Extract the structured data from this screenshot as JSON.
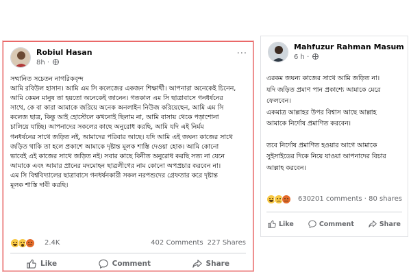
{
  "post1": {
    "author": "Robiul Hasan",
    "time": "8h",
    "more": "···",
    "lines": [
      "সম্মানিত সচেতন নাগরিকবৃন্দ",
      "আমি রবিউল হাসান। আমি এম সি কলেজের একজন শিক্ষার্থী। আপনারা অনেকেই চিনেন,",
      "আমি কেমন মানুষ তা হয়তো অনেকেই জানেন। গতকাল এম সি ছাত্রাবাসে গনধর্ষনের",
      "সাথে, কে বা কারা আমাকে জরিয়ে অনেক অনলাইন নিউজ করিয়েছেন, আমি এম সি",
      "কলেজ ছাত্র, কিন্তু আই হোস্টেলে কখনোই ছিলাম না, আমি বাসায় থেকে পড়াশোনা",
      "চালিয়ে যাচ্ছি। আপনাদের সকলের কাছে অনুরোধ করছি, আমি যদি এই নির্মম",
      "গনধর্ষনের সাথে জড়িত নই, আমাদের পরিবার আছে। যদি আমি এই জঘন্য কাজের সাথে",
      "জড়িত থাকি তা হলে প্রকাশে আমাকে দৃষ্টান্ত মূলক শাস্তি দেওয়া হোক। আমি কোনো",
      "ভাবেই এই কাজের সাথে জড়িত নই। সবার কাছে বিনীত অনুরোধ করছি সত্য না যেনে",
      "আমাকে এবং আমার প্রানের মদমোহন ছাত্রলীগের নাম কোনো অপপ্রচার করবেন না।",
      "এম সি বিশ্ববিদ্যালের ছাত্রাবাসে গনধর্ষনকারী সকল নরপশুদের গ্রেফতার করে দৃষ্টান্ত",
      "মূলক শাস্তি দাবী করছি।"
    ],
    "reactions_count": "2.4K",
    "comments": "402 Comments",
    "shares": "227 Shares",
    "like": "Like",
    "comment": "Comment",
    "share": "Share"
  },
  "post2": {
    "author": "Mahfuzur Rahman Masum",
    "time": "6 h",
    "more": "···",
    "lines": [
      "এরকম জঘন্য কাজের সাথে আমি জড়িত না।",
      "যদি জড়িত প্রমাণ পান প্রকাশ্যে আমাকে মেরে",
      "ফেলবেন।",
      "একমাত্র আল্লাহর উপর বিশ্বাস আছে আল্লাহ",
      "আমাকে নির্দোষ প্রমাণিত করবেন।"
    ],
    "lines_b": [
      "তবে নির্দোষ প্রমাণিত হওয়ার আগে আমাকে",
      "সুইসাইডের দিকে নিয়ে যাওয়া আপনাদের বিচার",
      "আল্লাহ করবেন।"
    ],
    "reactions_count": "630",
    "comments": "201 comments",
    "shares": "80 shares",
    "like": "Like",
    "comment": "Comment",
    "share": "Share"
  },
  "icons": {
    "avatar": "person-avatar",
    "globe": "globe-icon",
    "like": "thumbs-up-icon",
    "comment": "speech-bubble-icon",
    "share": "share-arrow-icon",
    "reactions": [
      "haha",
      "wow",
      "angry",
      "sad"
    ]
  },
  "colors": {
    "highlight_border": "#e85a5a",
    "meta_text": "#65676b",
    "text": "#050505"
  }
}
